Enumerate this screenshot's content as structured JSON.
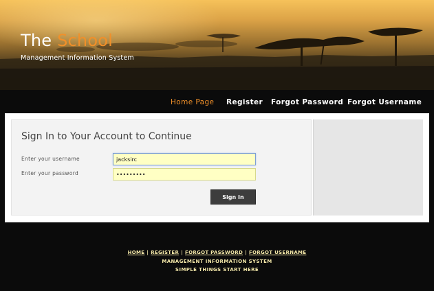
{
  "header": {
    "title_part1": "The",
    "title_part2": "School",
    "subtitle": "Management Information System"
  },
  "nav": {
    "items": [
      {
        "label": "Home Page",
        "active": true
      },
      {
        "label": "Register",
        "active": false
      },
      {
        "label": "Forgot Password",
        "active": false
      },
      {
        "label": "Forgot Username",
        "active": false
      }
    ]
  },
  "login": {
    "heading": "Sign In to Your Account to Continue",
    "username_label": "Enter your username",
    "username_value": "jacksirc",
    "password_label": "Enter your password",
    "password_value": "•••••••••",
    "submit_label": "Sign In"
  },
  "footer": {
    "links": [
      "HOME",
      "REGISTER",
      "FORGOT PASSWORD",
      "FORGOT USERNAME"
    ],
    "separator": "|",
    "line1": "MANAGEMENT INFORMATION SYSTEM",
    "line2": "SIMPLE THINGS START HERE"
  },
  "colors": {
    "accent": "#f0902a",
    "input_bg": "#ffffc4",
    "button_bg": "#3d3d3d",
    "footer_text": "#f3e7a8",
    "page_bg": "#0b0b0b"
  }
}
